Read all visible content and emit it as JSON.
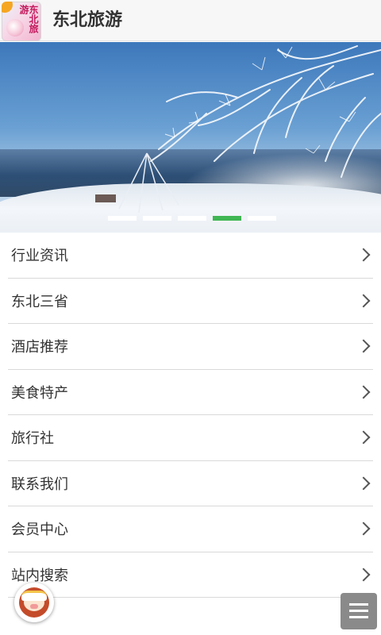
{
  "header": {
    "logo_text": "东北旅游",
    "title": "东北旅游"
  },
  "banner": {
    "slides": 5,
    "active_index": 3,
    "active_color": "#36b24a"
  },
  "menu": {
    "items": [
      {
        "label": "行业资讯",
        "icon": "chevron-right-icon"
      },
      {
        "label": "东北三省",
        "icon": "chevron-right-icon"
      },
      {
        "label": "酒店推荐",
        "icon": "chevron-right-icon"
      },
      {
        "label": "美食特产",
        "icon": "chevron-right-icon"
      },
      {
        "label": "旅行社",
        "icon": "chevron-right-icon"
      },
      {
        "label": "联系我们",
        "icon": "chevron-right-icon"
      },
      {
        "label": "会员中心",
        "icon": "chevron-right-icon"
      },
      {
        "label": "站内搜索",
        "icon": "chevron-right-icon"
      }
    ]
  },
  "floating": {
    "chat_icon": "chef-avatar-icon",
    "menu_icon": "hamburger-menu-icon"
  }
}
